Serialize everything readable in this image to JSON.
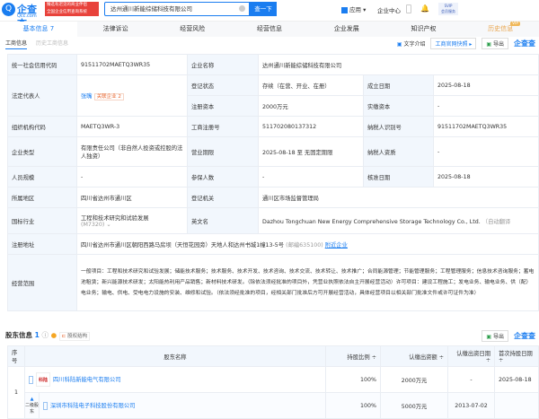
{
  "header": {
    "logo_title": "企查查",
    "logo_sub": "Qcc.com",
    "ad_line1": "臻选有迟见的商业伴侣",
    "ad_line2": "全国企业信用查询系统",
    "search_value": "达州通川新能综储科技有限公司",
    "search_button": "查一下",
    "apps": "应用",
    "user_center": "企业中心",
    "svip_line1": "SVIP",
    "svip_line2": "会员服务"
  },
  "nav": {
    "tabs": [
      {
        "label": "基本信息 7"
      },
      {
        "label": "法律诉讼"
      },
      {
        "label": "经营风险"
      },
      {
        "label": "经营信息"
      },
      {
        "label": "企业发展"
      },
      {
        "label": "知识产权"
      },
      {
        "label": "历史信息"
      }
    ],
    "vip": "VIP"
  },
  "subtabs": [
    "工商信息",
    "历史工商信息"
  ],
  "tools": {
    "text_intro": "文字介绍",
    "snapshot": "工商官网快照",
    "export": "导出",
    "brand": "企查查"
  },
  "info": {
    "credit_code_label": "统一社会信用代码",
    "credit_code": "91511702MAETQ3WR35",
    "name_label": "企业名称",
    "name": "达州通川新能综储科技有限公司",
    "legal_label": "法定代表人",
    "legal": "张嘴",
    "related": "关联企业 2",
    "status_label": "登记状态",
    "status": "存续（在营、开业、在册）",
    "founded_label": "成立日期",
    "founded": "2025-08-18",
    "capital_label": "注册资本",
    "capital": "2000万元",
    "paid_label": "实缴资本",
    "paid": "-",
    "org_label": "组织机构代码",
    "org": "MAETQ3WR-3",
    "reg_label": "工商注册号",
    "reg": "511702080137312",
    "taxid_label": "纳税人识别号",
    "taxid": "91511702MAETQ3WR35",
    "type_label": "企业类型",
    "type": "有限责任公司（非自然人投资或控股的法人独资）",
    "term_label": "营业期限",
    "term": "2025-08-18 至 无固定期限",
    "taxq_label": "纳税人资质",
    "taxq": "-",
    "staff_label": "人员规模",
    "staff": "-",
    "insured_label": "参保人数",
    "insured": "-",
    "approve_label": "核准日期",
    "approve": "2025-08-18",
    "region_label": "所属地区",
    "region": "四川省达州市通川区",
    "authority_label": "登记机关",
    "authority": "通川区市场监督管理局",
    "industry_label": "国标行业",
    "industry": "工程和技术研究和试验发展",
    "industry_code": "(M7320)",
    "en_label": "英文名",
    "en": "Dazhou Tongchuan New Energy Comprehensive Storage Technology Co., Ltd.",
    "en_note": "（自动翻译",
    "addr_label": "注册地址",
    "addr": "四川省达州市通川区朝阳西路马房坝（天恒花园旁）天地人和达州书城1幢13-5号",
    "postcode": "(邮编635100)",
    "nearby": "附近企业",
    "scope_label": "经营范围",
    "scope": "一般项目：工程和技术研究和试验发展；储能技术服务；技术服务、技术开发、技术咨询、技术交流、技术转让、技术推广；合同能源管理；节能管理服务；工程管理服务；信息技术咨询服务；蓄电池租赁；新兴能源技术研发；太阳能热利用产品销售；新材料技术研发。（除依法须经批准的项目外，凭营业执照依法自主开展经营活动）许可项目：建设工程施工；发电业务、输电业务、供（配）电业务；输电、供电、受电电力设施的安装、维修和试验。（依法须经批准的项目，经相关部门批准后方可开展经营活动，具体经营项目以相关部门批准文件或许可证件为准）"
  },
  "shareholders": {
    "title": "股东信息",
    "count": "1",
    "equity": "股权结构",
    "export": "导出",
    "brand": "企查查",
    "headers": [
      "序号",
      "股东名称",
      "持股比例 ÷",
      "认缴出资额 ÷",
      "认缴出资日期 ÷",
      "首次持股日期 ÷"
    ],
    "rows": [
      {
        "no": "1",
        "logo": "科陆",
        "name": "四川科陆新能电气有限公司",
        "ratio": "100%",
        "amount": "2000万元",
        "date": "-",
        "first": "2025-08-18"
      },
      {
        "level": "二级股东",
        "name": "深圳市科陆电子科技股份有限公司",
        "ratio": "100%",
        "amount": "5000万元",
        "date": "2013-07-02",
        "first": ""
      }
    ]
  }
}
